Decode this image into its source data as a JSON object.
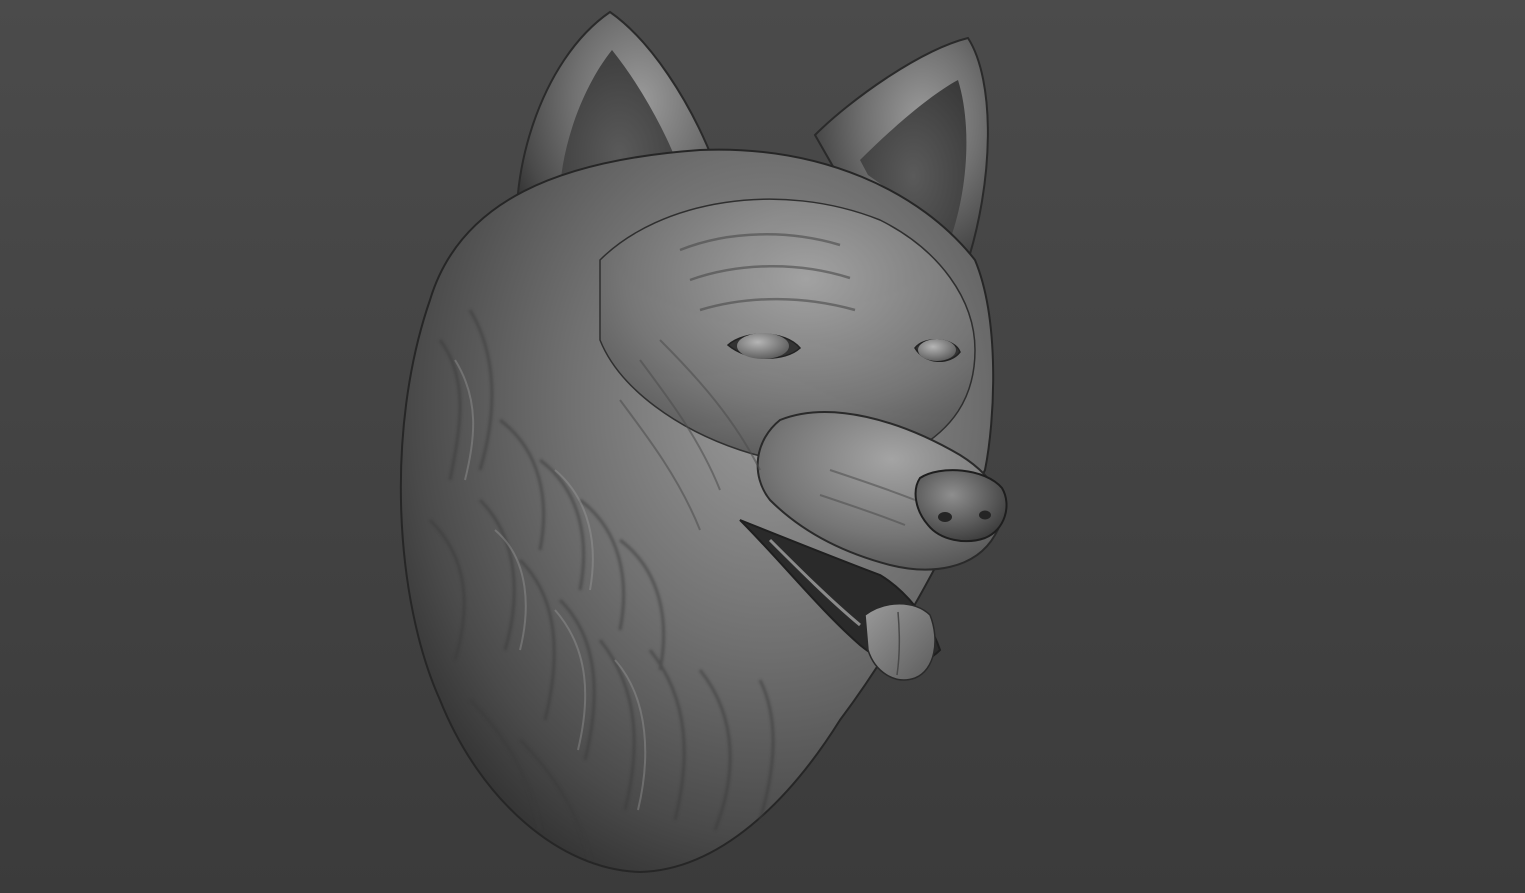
{
  "scene": {
    "subject": "wolf-head-sculpt",
    "colors": {
      "background_top": "#4a4a4a",
      "background_bottom": "#3c3c3c",
      "clay_highlight": "#b8b8b8",
      "clay_mid": "#7a7a7a",
      "clay_dark": "#3a3a3a",
      "clay_shadow": "#262626"
    }
  }
}
